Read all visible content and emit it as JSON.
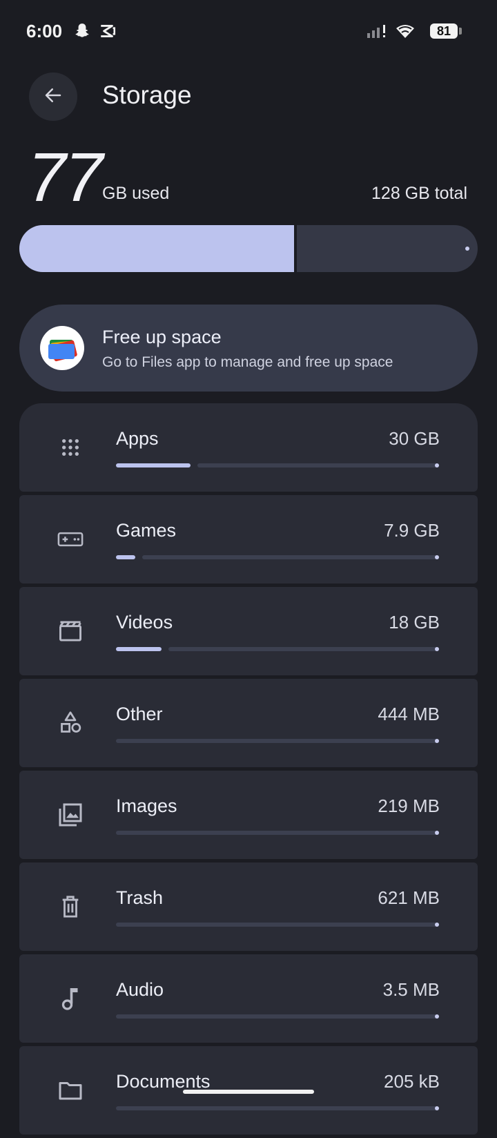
{
  "status_bar": {
    "time": "6:00",
    "battery": "81"
  },
  "header": {
    "title": "Storage"
  },
  "usage": {
    "used_value": "77",
    "used_label": "GB used",
    "total_label": "128 GB total",
    "used_fraction": 0.6
  },
  "free_up": {
    "title": "Free up space",
    "subtitle": "Go to Files app to manage and free up space"
  },
  "categories": [
    {
      "name": "Apps",
      "size": "30 GB",
      "icon": "grid-dots-icon",
      "fraction": 0.23
    },
    {
      "name": "Games",
      "size": "7.9 GB",
      "icon": "gamepad-icon",
      "fraction": 0.06
    },
    {
      "name": "Videos",
      "size": "18 GB",
      "icon": "clapperboard-icon",
      "fraction": 0.14
    },
    {
      "name": "Other",
      "size": "444 MB",
      "icon": "shapes-icon",
      "fraction": 0.0
    },
    {
      "name": "Images",
      "size": "219 MB",
      "icon": "image-icon",
      "fraction": 0.0
    },
    {
      "name": "Trash",
      "size": "621 MB",
      "icon": "trash-icon",
      "fraction": 0.0
    },
    {
      "name": "Audio",
      "size": "3.5 MB",
      "icon": "music-note-icon",
      "fraction": 0.0
    },
    {
      "name": "Documents",
      "size": "205 kB",
      "icon": "folder-icon",
      "fraction": 0.0
    }
  ],
  "colors": {
    "background": "#1b1c22",
    "accent": "#bcc3ee",
    "card": "#2a2c36"
  }
}
